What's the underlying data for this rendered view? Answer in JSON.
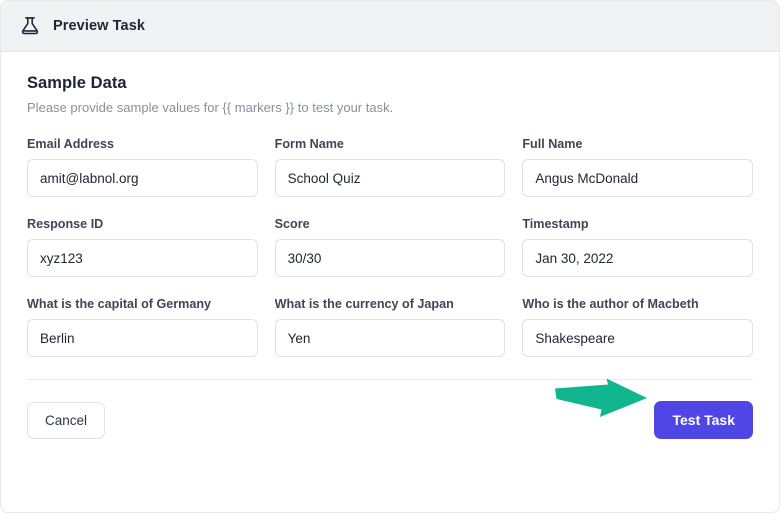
{
  "window": {
    "title": "Preview Task",
    "icon": "flask-icon"
  },
  "section": {
    "heading": "Sample Data",
    "description": "Please provide sample values for {{ markers }} to test your task."
  },
  "fields": [
    {
      "label": "Email Address",
      "value": "amit@labnol.org",
      "placeholder": "Email Address"
    },
    {
      "label": "Form Name",
      "value": "School Quiz",
      "placeholder": "Form Name"
    },
    {
      "label": "Full Name",
      "value": "Angus McDonald",
      "placeholder": "Full Name"
    },
    {
      "label": "Response ID",
      "value": "xyz123",
      "placeholder": "Response ID"
    },
    {
      "label": "Score",
      "value": "30/30",
      "placeholder": "Score"
    },
    {
      "label": "Timestamp",
      "value": "Jan 30, 2022",
      "placeholder": "Timestamp"
    },
    {
      "label": "What is the capital of Germany",
      "value": "Berlin",
      "placeholder": "What is the capital of Germany"
    },
    {
      "label": "What is the currency of Japan",
      "value": "Yen",
      "placeholder": "What is the currency of Japan"
    },
    {
      "label": "Who is the author of Macbeth",
      "value": "Shakespeare",
      "placeholder": "Who is the author of Macbeth"
    }
  ],
  "footer": {
    "cancel_label": "Cancel",
    "submit_label": "Test Task",
    "annotation_arrow": "arrow-right-annotation"
  },
  "colors": {
    "primary_button": "#4f46e5",
    "annotation_arrow": "#11b68f",
    "titlebar_background": "#f1f2f4",
    "label_text": "#3f4656",
    "muted_text": "#8a8f9d",
    "border": "#dfe1e6"
  }
}
